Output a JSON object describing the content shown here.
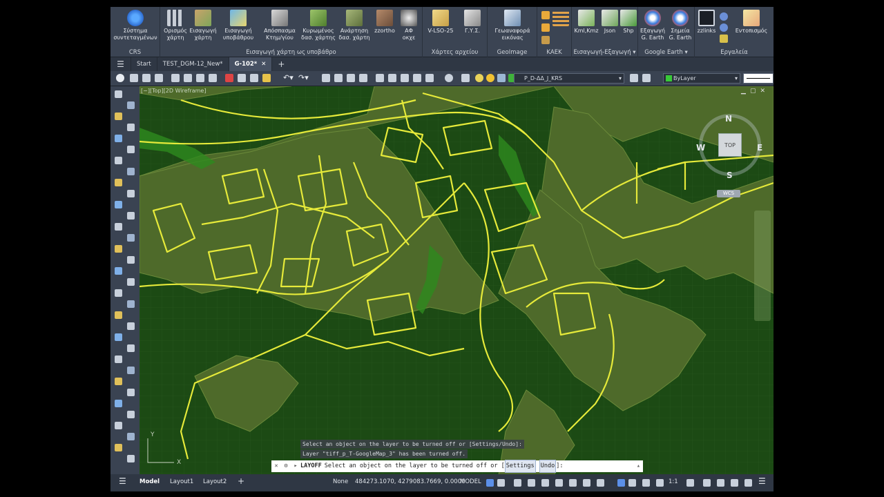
{
  "ribbon": {
    "crs": {
      "label": "Σύστημα\nσυντεταγμένων",
      "group": "CRS"
    },
    "import_group": {
      "buttons": [
        "Ορισμός\nχάρτη",
        "Εισαγωγή\nχάρτη",
        "Εισαγωγή\nυποβάθρου",
        "Απόσπασμα\nΚτημ/γίου",
        "Κυρωμένος\nδασ. χάρτης",
        "Ανάρτηση\nδασ. χάρτη",
        "zzortho",
        "ΑΦ\nοκχε"
      ],
      "group": "Εισαγωγή χάρτη ως υποβάθρο"
    },
    "archive": {
      "buttons": [
        "V-LSO-25",
        "Γ.Υ.Σ."
      ],
      "group": "Χάρτες αρχείου"
    },
    "geoimage": {
      "label": "Γεωαναφορά\nεικόνας",
      "group": "GeoImage"
    },
    "kaek": {
      "group": "ΚΑΕΚ"
    },
    "export": {
      "buttons": [
        "Kml,Kmz",
        "Json",
        "Shp"
      ],
      "group": "Εισαγωγή-Εξαγωγή"
    },
    "gearth": {
      "buttons": [
        "Εξαγωγή\nG. Earth",
        "Σημεία\nG. Earth"
      ],
      "group": "Google Earth"
    },
    "tools": {
      "buttons": [
        "zzlinks",
        "Εντοπισμός"
      ],
      "group": "Εργαλεία"
    }
  },
  "tabs": [
    "Start",
    "TEST_DGM-12_New*",
    "G-102*"
  ],
  "toolbar": {
    "layer_combo": "P_D-ΔΔ_J_KRS",
    "color_combo": "ByLayer"
  },
  "viewport": {
    "label": "[−][Top][2D Wireframe]"
  },
  "viewcube": {
    "n": "N",
    "s": "S",
    "e": "E",
    "w": "W",
    "top": "TOP",
    "wcs": "WCS"
  },
  "ucs": {
    "y": "Y",
    "x": "X"
  },
  "command": {
    "history1": "Select an object on the layer to be turned off or [Settings/Undo]:",
    "history2": "Layer \"tiff_p_T-GoogleMap_3\" has been turned off.",
    "name": "LAYOFF",
    "prompt": "Select an object on the layer to be turned off or [",
    "opt1": "Settings",
    "opt2": "Undo",
    "end": "]:"
  },
  "status": {
    "tabs": [
      "Model",
      "Layout1",
      "Layout2"
    ],
    "snap": "None",
    "coords": "484273.1070, 4279083.7669, 0.0000",
    "space": "MODEL",
    "scale": "1:1"
  },
  "colors": {
    "canvas_bg": "#1c4a14",
    "parcel": "#e6ea3a",
    "zone": "#4e6a2a",
    "ribbon": "#3b4453"
  }
}
